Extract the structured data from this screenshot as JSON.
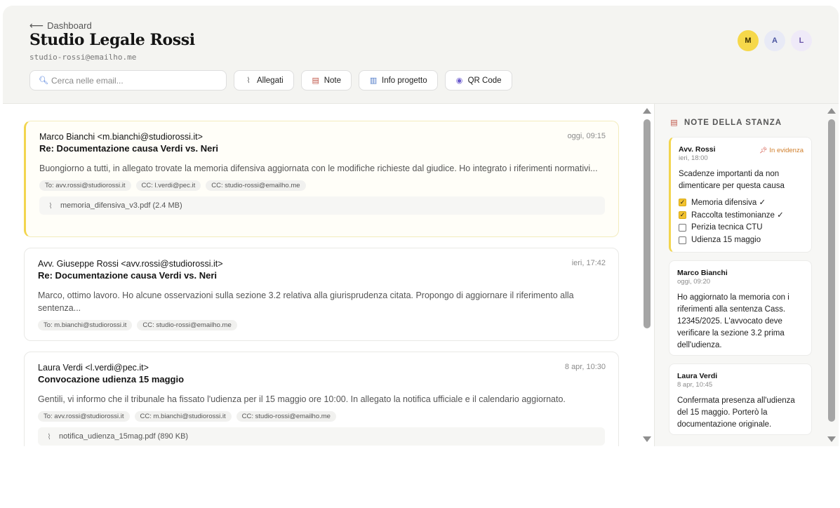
{
  "header": {
    "back_label": "Dashboard",
    "title": "Studio Legale Rossi",
    "email": "studio-rossi@emailho.me",
    "avatars": [
      {
        "initial": "M",
        "bg": "#f6d84a",
        "fg": "#3a2e00"
      },
      {
        "initial": "A",
        "bg": "#e8eaf6",
        "fg": "#4a55a0"
      },
      {
        "initial": "L",
        "bg": "#efeaf8",
        "fg": "#6a55a8"
      }
    ]
  },
  "toolbar": {
    "search_placeholder": "Cerca nelle email...",
    "buttons": [
      {
        "label": "Allegati",
        "icon": "paperclip-icon",
        "glyph": "✎"
      },
      {
        "label": "Note",
        "icon": "clipboard-icon",
        "glyph": "▤"
      },
      {
        "label": "Info progetto",
        "icon": "chart-icon",
        "glyph": "▥"
      },
      {
        "label": "QR Code",
        "icon": "qr-icon",
        "glyph": "◉"
      }
    ]
  },
  "emails": [
    {
      "from": "Marco Bianchi <m.bianchi@studiorossi.it>",
      "subject": "Re: Documentazione causa Verdi vs. Neri",
      "time": "oggi, 09:15",
      "body": "Buongiorno a tutti, in allegato trovate la memoria difensiva aggiornata con le modifiche richieste dal giudice. Ho integrato i riferimenti normativi...",
      "chips": [
        "To: avv.rossi@studiorossi.it",
        "CC: l.verdi@pec.it",
        "CC: studio-rossi@emailho.me"
      ],
      "attachment": "memoria_difensiva_v3.pdf (2.4 MB)"
    },
    {
      "from": "Avv. Giuseppe Rossi <avv.rossi@studiorossi.it>",
      "subject": "Re: Documentazione causa Verdi vs. Neri",
      "time": "ieri, 17:42",
      "body": "Marco, ottimo lavoro. Ho alcune osservazioni sulla sezione 3.2 relativa alla giurisprudenza citata. Propongo di aggiornare il riferimento alla sentenza...",
      "chips": [
        "To: m.bianchi@studiorossi.it",
        "CC: studio-rossi@emailho.me"
      ]
    },
    {
      "from": "Laura Verdi <l.verdi@pec.it>",
      "subject": "Convocazione udienza 15 maggio",
      "time": "8 apr, 10:30",
      "body": "Gentili, vi informo che il tribunale ha fissato l'udienza per il 15 maggio ore 10:00. In allegato la notifica ufficiale e il calendario aggiornato.",
      "chips": [
        "To: avv.rossi@studiorossi.it",
        "CC: m.bianchi@studiorossi.it",
        "CC: studio-rossi@emailho.me"
      ],
      "attachment": "notifica_udienza_15mag.pdf (890 KB)"
    }
  ],
  "notes_panel": {
    "title": "NOTE DELLA STANZA",
    "pinned": {
      "author": "Avv. Rossi",
      "time": "ieri, 18:00",
      "badge": "In evidenza",
      "text": "Scadenze importanti da non dimenticare per questa causa",
      "items": [
        {
          "label": "Memoria difensiva ✓",
          "checked": true
        },
        {
          "label": "Raccolta testimonianze ✓",
          "checked": true
        },
        {
          "label": "Perizia tecnica CTU",
          "checked": false
        },
        {
          "label": "Udienza 15 maggio",
          "checked": false
        }
      ]
    },
    "notes": [
      {
        "author": "Marco Bianchi",
        "time": "oggi, 09:20",
        "text": "Ho aggiornato la memoria con i riferimenti alla sentenza Cass. 12345/2025. L'avvocato deve verificare la sezione 3.2 prima dell'udienza."
      },
      {
        "author": "Laura Verdi",
        "time": "8 apr, 10:45",
        "text": "Confermata presenza all'udienza del 15 maggio. Porterò la documentazione originale."
      }
    ]
  }
}
